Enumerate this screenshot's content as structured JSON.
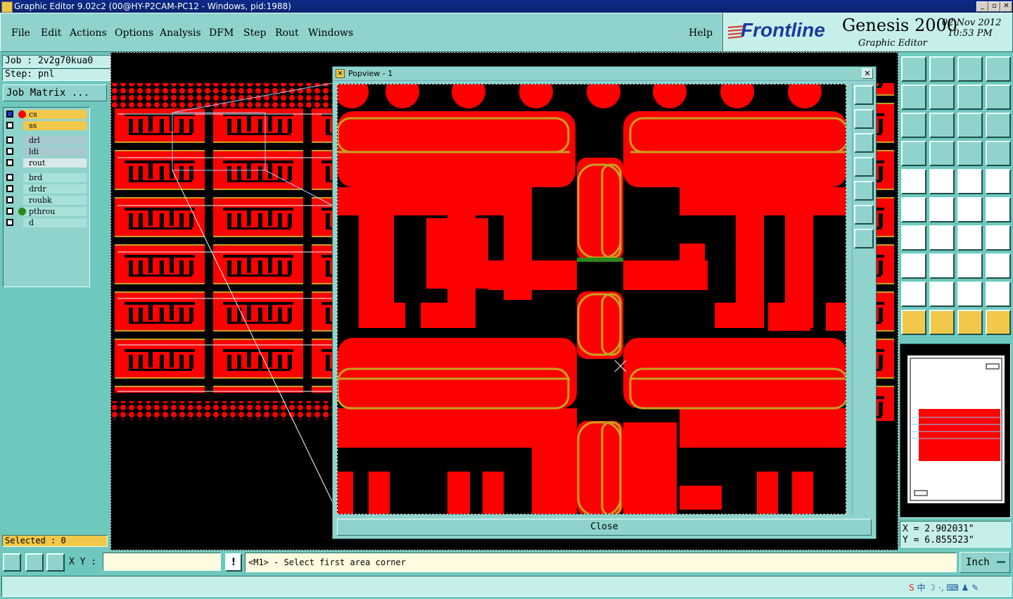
{
  "window": {
    "title": "Graphic Editor 9.02c2 (00@HY-P2CAM-PC12 - Windows, pid:1988)"
  },
  "menu": [
    "File",
    "Edit",
    "Actions",
    "Options",
    "Analysis",
    "DFM",
    "Step",
    "Rout",
    "Windows"
  ],
  "help_label": "Help",
  "brand": {
    "logo": "Frontline",
    "product": "Genesis 2000",
    "subtitle": "Graphic Editor",
    "date": "02 Nov 2012",
    "time": "10:53 PM"
  },
  "job": {
    "job_label": "Job : 2v2g70kua0",
    "step_label": "Step: pnl",
    "matrix_button": "Job Matrix ..."
  },
  "layers": [
    {
      "name": "cs",
      "checked": true,
      "color": "#ff0000",
      "highlight": "#f2c84a"
    },
    {
      "name": "ss",
      "checked": false,
      "color": "",
      "highlight": "#f2c84a"
    },
    {
      "name": "drl",
      "checked": false,
      "color": "",
      "highlight": "#a8c8d0"
    },
    {
      "name": "ldi",
      "checked": false,
      "color": "",
      "highlight": "#a8c8d0"
    },
    {
      "name": "rout",
      "checked": false,
      "color": "",
      "highlight": "#d8e8e8"
    },
    {
      "name": "brd",
      "checked": false,
      "color": "",
      "highlight": "#a8e0da"
    },
    {
      "name": "drdr",
      "checked": false,
      "color": "",
      "highlight": "#a8e0da"
    },
    {
      "name": "roubk",
      "checked": false,
      "color": "",
      "highlight": "#a8e0da"
    },
    {
      "name": "pthrou",
      "checked": false,
      "color": "#2a8a1a",
      "highlight": "#a8e0da"
    },
    {
      "name": "d",
      "checked": false,
      "color": "",
      "highlight": "#a8e0da"
    }
  ],
  "selected_label": "Selected : 0",
  "popview": {
    "title": "Popview - 1",
    "close_label": "Close"
  },
  "coords": {
    "x": "X = 2.902031\"",
    "y": "Y = 6.855523\""
  },
  "bottom": {
    "xy_label": "X Y :",
    "xy_value": "",
    "prompt": "<M1> - Select first area corner",
    "units": "Inch"
  },
  "colors": {
    "teal": "#8fd3cc",
    "teal_dark": "#6ec8bd",
    "copper": "#ff0000",
    "outline": "#c8a020"
  }
}
